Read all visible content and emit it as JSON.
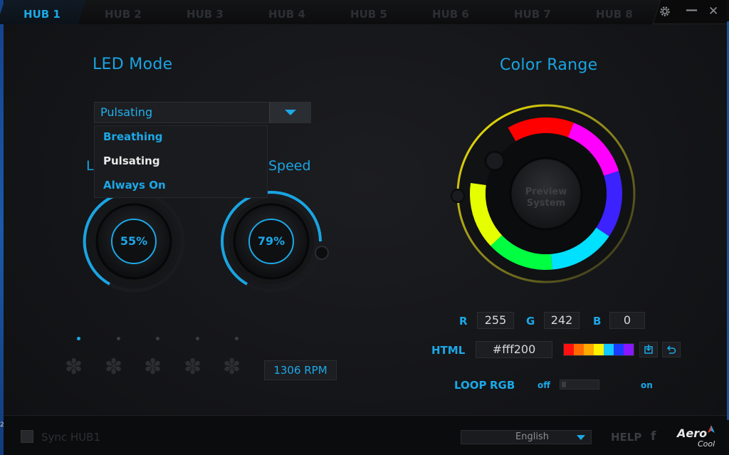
{
  "tabs": [
    {
      "label": "HUB 1",
      "active": true
    },
    {
      "label": "HUB 2",
      "active": false
    },
    {
      "label": "HUB 3",
      "active": false
    },
    {
      "label": "HUB 4",
      "active": false
    },
    {
      "label": "HUB 5",
      "active": false
    },
    {
      "label": "HUB 6",
      "active": false
    },
    {
      "label": "HUB 7",
      "active": false
    },
    {
      "label": "HUB 8",
      "active": false
    }
  ],
  "window_controls": {
    "settings_icon": "gear-icon",
    "minimize": "—",
    "close": "✕"
  },
  "led": {
    "title": "LED Mode",
    "selected": "Pulsating",
    "options": [
      "Breathing",
      "Pulsating",
      "Always On"
    ],
    "brightness_label_fragment": "L",
    "speed_label": "Speed",
    "brightness": {
      "text": "55%",
      "value": 55
    },
    "speed": {
      "text": "79%",
      "value": 79
    }
  },
  "fans": {
    "count": 5,
    "active_index": 0,
    "rpm": "1306 RPM"
  },
  "color": {
    "title": "Color Range",
    "preview_line1": "Preview",
    "preview_line2": "System",
    "r_label": "R",
    "r": "255",
    "g_label": "G",
    "g": "242",
    "b_label": "B",
    "b": "0",
    "html_label": "HTML",
    "html_value": "#fff200",
    "swatches": [
      "#ff1010",
      "#ff6a00",
      "#ffa800",
      "#fff200",
      "#11c8ff",
      "#1a3cff",
      "#8a18ff"
    ],
    "loop_label": "LOOP",
    "rgb_label": "RGB",
    "off_label": "off",
    "on_label": "on"
  },
  "footer": {
    "sync_label": "Sync HUB1",
    "language": "English",
    "help": "HELP",
    "facebook": "f",
    "logo_main": "Aero",
    "logo_sub": "Cool"
  },
  "desktop": {
    "edge_number": "2"
  }
}
